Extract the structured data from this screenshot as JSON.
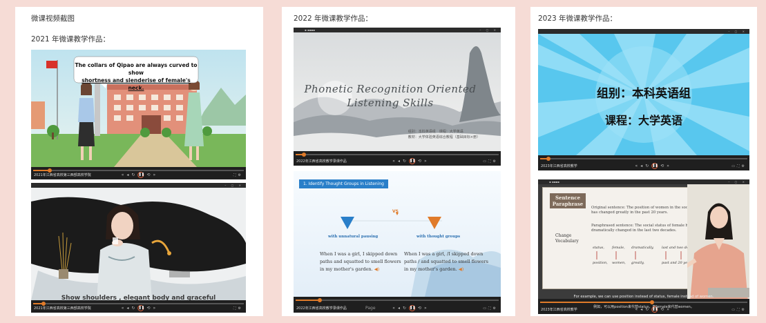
{
  "panel1": {
    "title": "微课视频截图",
    "subtitle": "2021 年微课教学作品：",
    "video1": {
      "speech_line1": "The collars of Qipao are always curved to show",
      "speech_line2": "shortness and slenderise of female's neck.",
      "player_title": "2021年江西省高校第三西部高校学院",
      "progress": 0.08
    },
    "video2": {
      "subtitle_text": "Show shoulders , elegant body and graceful",
      "player_title": "2021年江西省高校第三西部高校学院",
      "progress": 0.05
    }
  },
  "panel2": {
    "title": "2022 年微课教学作品：",
    "video1": {
      "heading_line1": "Phonetic Recognition Oriented",
      "heading_line2": "Listening Skills",
      "info_line1": "组别：本科英语组　课程：大学英语",
      "info_line2": "教材：大学体验英语综合教程（基础目标×册）",
      "player_title": "2022年江西省高校教学录课作品",
      "progress": 0.04
    },
    "video2": {
      "section_header": "1. Identify Thought Groups in Listening",
      "vs_label": "VS",
      "left_label": "with unnatural pausing",
      "right_label": "with thought groups",
      "left_para": [
        "When I was a girl, I skipped down",
        "paths and squatted to smell flowers",
        "in my mother's garden."
      ],
      "right_para": [
        "When I was a girl, /I skipped down",
        "paths / and squatted to smell flowers",
        "in my mother's garden."
      ],
      "player_title": "2022年江西省高校教学录课作品",
      "page_label": "Page",
      "progress": 0.12
    }
  },
  "panel3": {
    "title": "2023 年微课教学作品：",
    "video1": {
      "group_line": "组别：本科英语组",
      "course_line": "课程：大学英语",
      "player_title": "2023年江西省高校教学",
      "progress": 0.04
    },
    "video2": {
      "board_title_line1": "Sentence",
      "board_title_line2": "Paraphrase",
      "change_label_line1": "Change",
      "change_label_line2": "Vocabulary",
      "original": [
        "Original sentence: The position of women in the society",
        "has changed greatly in the past 20 years."
      ],
      "paraphrased": [
        "Paraphrased sentence: The social status of female has",
        "dramatically changed in the last two decades."
      ],
      "vocab_top": [
        "status,",
        "female,",
        "dramatically,",
        "last and two decades"
      ],
      "vocab_bottom": [
        "position,",
        "women,",
        "greatly,",
        "past and 20 years"
      ],
      "caption_line1": "For example, we can use position instead of status, female instead of women.",
      "caption_line2": "例如，可以用position来代替status，用female来代替women。",
      "player_title": "2023年江西省高校教学",
      "progress": 0.54
    }
  },
  "colors": {
    "background": "#f6dcd6",
    "accent_orange": "#e07b2a",
    "accent_blue": "#2a7fc9"
  }
}
